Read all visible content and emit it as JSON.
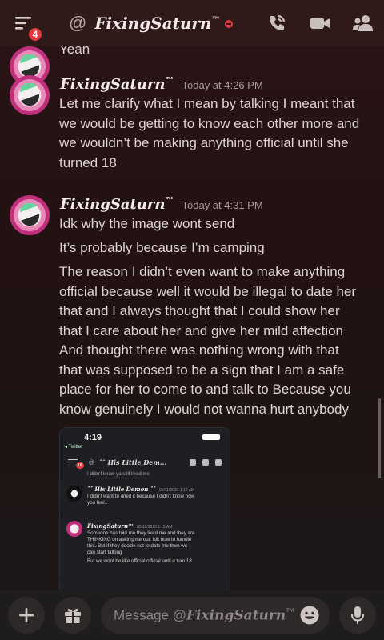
{
  "header": {
    "badge_count": "4",
    "at_symbol": "@",
    "channel_name": "FixingSaturn",
    "channel_tm": "™"
  },
  "prev_message": {
    "text": "Yeah"
  },
  "messages": [
    {
      "author": "FixingSaturn",
      "author_tm": "™",
      "timestamp": "Today at 4:26 PM",
      "lines": [
        "Let me clarify what I mean by talking I meant that",
        "we would be getting to know each other more and",
        "we wouldn’t be making anything official until she",
        "turned 18"
      ]
    },
    {
      "author": "FixingSaturn",
      "author_tm": "™",
      "timestamp": "Today at 4:31 PM",
      "line_a": "Idk why the image wont send",
      "line_b": "It’s probably because I’m camping",
      "lines": [
        "The reason I didn’t even want to make anything",
        "official because well it would be illegal to date her",
        "that and I always thought that I could show her",
        "that I care about her and give her mild affection",
        "And thought there was nothing wrong with that",
        "that was supposed to be a sign that I am a safe",
        "place for her to come to and talk to Because you",
        "know genuinely I would not wanna hurt anybody"
      ]
    }
  ],
  "embed": {
    "time": "4:19",
    "back_label": "◂ Twitter",
    "badge": "18",
    "channel": "ˆˆ His Little Dem...",
    "top_line": "I didn’t know ya still liked me",
    "msg1_author": "ˆˆ His Little Demon ˆˆ",
    "msg1_ts": "05/11/2023 1:12 AM",
    "msg1_lines": [
      "I didn’t want to amid it because I didn’t know how",
      "you feel.."
    ],
    "msg2_author": "FixingSaturn™",
    "msg2_ts": "05/11/2023 1:15 AM",
    "msg2_lines": [
      "Someone has told me they liked me and they are",
      "THINKING on asking me out. Idk how to handle",
      "this. But if they decide not to date me then we",
      "can start talking",
      "But we wont be like official official until u turn 18"
    ]
  },
  "input": {
    "placeholder_prefix": "Message @",
    "placeholder_name": "FixingSaturn",
    "placeholder_tm": "™"
  },
  "icons": {
    "menu": "hamburger-menu-icon",
    "call": "phone-call-icon",
    "video": "video-camera-icon",
    "members": "members-icon",
    "add": "plus-icon",
    "gift": "gift-icon",
    "emoji": "emoji-icon",
    "mic": "microphone-icon"
  },
  "colors": {
    "badge": "#e0393e",
    "header_bg": "#2f1a19"
  }
}
